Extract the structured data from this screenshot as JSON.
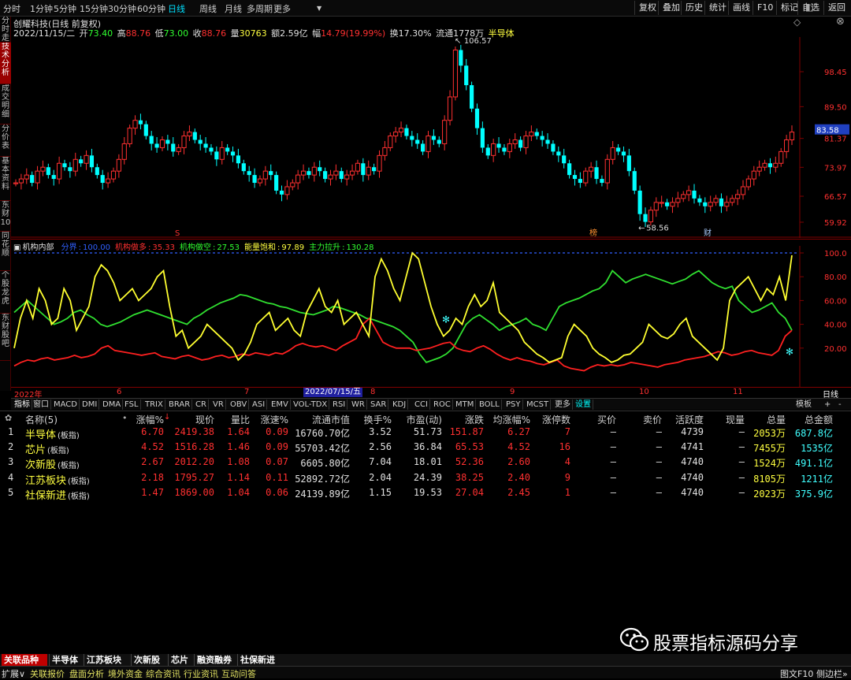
{
  "toolbar": {
    "left_items": [
      "分时",
      "1分钟",
      "5分钟",
      "15分钟",
      "30分钟",
      "60分钟",
      "日线",
      "周线",
      "月线",
      "多周期",
      "更多"
    ],
    "active": "日线",
    "right_items": [
      "复权",
      "叠加",
      "历史",
      "统计",
      "画线",
      "F10",
      "标记",
      "自选",
      "返回"
    ]
  },
  "left_tabs": [
    "分时走势",
    "技术分析",
    "成交明细",
    "分价表",
    "基本资料",
    "东财10",
    "同花顺",
    "个股龙虎",
    "东财股吧"
  ],
  "left_tab_active": 1,
  "header": {
    "title": "创耀科技(日线 前复权)",
    "date": "2022/11/15/二",
    "open_label": "开",
    "open": "73.40",
    "high_label": "高",
    "high": "88.76",
    "low_label": "低",
    "low": "73.00",
    "close_label": "收",
    "close": "88.76",
    "vol_label": "量",
    "vol": "30763",
    "amount_label": "额",
    "amount": "2.59亿",
    "change_label": "幅",
    "change": "14.79(19.99%)",
    "turnover_label": "换",
    "turnover": "17.30%",
    "float_label": "流通",
    "float": "1778万",
    "sector": "半导体"
  },
  "price_chart": {
    "y_labels": [
      "98.45",
      "89.50",
      "81.37",
      "73.97",
      "66.57",
      "59.92"
    ],
    "current_price": "83.58",
    "high_mark": "106.57",
    "low_mark": "58.56",
    "markers": [
      "S",
      "榜",
      "财"
    ]
  },
  "indicator": {
    "name": "机构内部",
    "items": [
      {
        "label": "分界",
        "value": "100.00",
        "color": "#3060ff"
      },
      {
        "label": "机构做多",
        "value": "35.33",
        "color": "#ff3030"
      },
      {
        "label": "机构做空",
        "value": "27.53",
        "color": "#30ff30"
      },
      {
        "label": "能量饱和",
        "value": "97.89",
        "color": "#ffff40"
      },
      {
        "label": "主力拉升",
        "value": "130.28",
        "color": "#30ff30"
      }
    ],
    "y_labels": [
      "100.0",
      "80.00",
      "60.00",
      "40.00",
      "20.00"
    ]
  },
  "date_axis": {
    "labels": [
      "2022年",
      "6",
      "7",
      "8",
      "9",
      "10",
      "11"
    ],
    "highlight": "2022/07/15/五",
    "right_label": "日线"
  },
  "indicator_tabs": [
    "指标",
    "窗口",
    "MACD",
    "DMI",
    "DMA",
    "FSL",
    "TRIX",
    "BRAR",
    "CR",
    "VR",
    "OBV",
    "ASI",
    "EMV",
    "VOL-TDX",
    "RSI",
    "WR",
    "SAR",
    "KDJ",
    "CCI",
    "ROC",
    "MTM",
    "BOLL",
    "PSY",
    "MCST",
    "更多",
    "设置"
  ],
  "indicator_tabs_right": [
    "模板",
    "+",
    "-"
  ],
  "table": {
    "headers": [
      "名称(5)",
      "涨幅%",
      "现价",
      "量比",
      "涨速%",
      "流通市值",
      "换手%",
      "市盈(动)",
      "涨跌",
      "均涨幅%",
      "涨停数",
      "买价",
      "卖价",
      "活跃度",
      "现量",
      "总量",
      "总金额"
    ],
    "rows": [
      {
        "idx": "1",
        "name": "半导体",
        "tag": "(板指)",
        "chg": "6.70",
        "price": "2419.38",
        "vr": "1.64",
        "spd": "0.09",
        "mcap": "16760.70亿",
        "turn": "3.52",
        "pe": "51.73",
        "diff": "151.87",
        "avg": "6.27",
        "limit": "7",
        "bid": "–",
        "ask": "–",
        "act": "4739",
        "cur": "–",
        "vol": "2053万",
        "amt": "687.8亿"
      },
      {
        "idx": "2",
        "name": "芯片",
        "tag": "(板指)",
        "chg": "4.52",
        "price": "1516.28",
        "vr": "1.46",
        "spd": "0.09",
        "mcap": "55703.42亿",
        "turn": "2.56",
        "pe": "36.84",
        "diff": "65.53",
        "avg": "4.52",
        "limit": "16",
        "bid": "–",
        "ask": "–",
        "act": "4741",
        "cur": "–",
        "vol": "7455万",
        "amt": "1535亿"
      },
      {
        "idx": "3",
        "name": "次新股",
        "tag": "(板指)",
        "chg": "2.67",
        "price": "2012.20",
        "vr": "1.08",
        "spd": "0.07",
        "mcap": "6605.80亿",
        "turn": "7.04",
        "pe": "18.01",
        "diff": "52.36",
        "avg": "2.60",
        "limit": "4",
        "bid": "–",
        "ask": "–",
        "act": "4740",
        "cur": "–",
        "vol": "1524万",
        "amt": "491.1亿"
      },
      {
        "idx": "4",
        "name": "江苏板块",
        "tag": "(板指)",
        "chg": "2.18",
        "price": "1795.27",
        "vr": "1.14",
        "spd": "0.11",
        "mcap": "52892.72亿",
        "turn": "2.04",
        "pe": "24.39",
        "diff": "38.25",
        "avg": "2.40",
        "limit": "9",
        "bid": "–",
        "ask": "–",
        "act": "4740",
        "cur": "–",
        "vol": "8105万",
        "amt": "1211亿"
      },
      {
        "idx": "5",
        "name": "社保新进",
        "tag": "(板指)",
        "chg": "1.47",
        "price": "1869.00",
        "vr": "1.04",
        "spd": "0.06",
        "mcap": "24139.89亿",
        "turn": "1.15",
        "pe": "19.53",
        "diff": "27.04",
        "avg": "2.45",
        "limit": "1",
        "bid": "–",
        "ask": "–",
        "act": "4740",
        "cur": "–",
        "vol": "2023万",
        "amt": "375.9亿"
      }
    ]
  },
  "bottom_tabs": [
    "关联品种",
    "半导体",
    "江苏板块",
    "次新股",
    "芯片",
    "融资融券",
    "社保新进"
  ],
  "bottom_status": [
    "扩展∨",
    "关联报价",
    "盘面分析",
    "境外资金",
    "综合资讯",
    "行业资讯",
    "互动问答",
    "图文F10",
    "侧边栏»"
  ],
  "watermark": "股票指标源码分享",
  "colors": {
    "up": "#ff3030",
    "down": "#00ffff",
    "yellow": "#ffff40",
    "green": "#30ff30",
    "blue": "#3060ff"
  }
}
